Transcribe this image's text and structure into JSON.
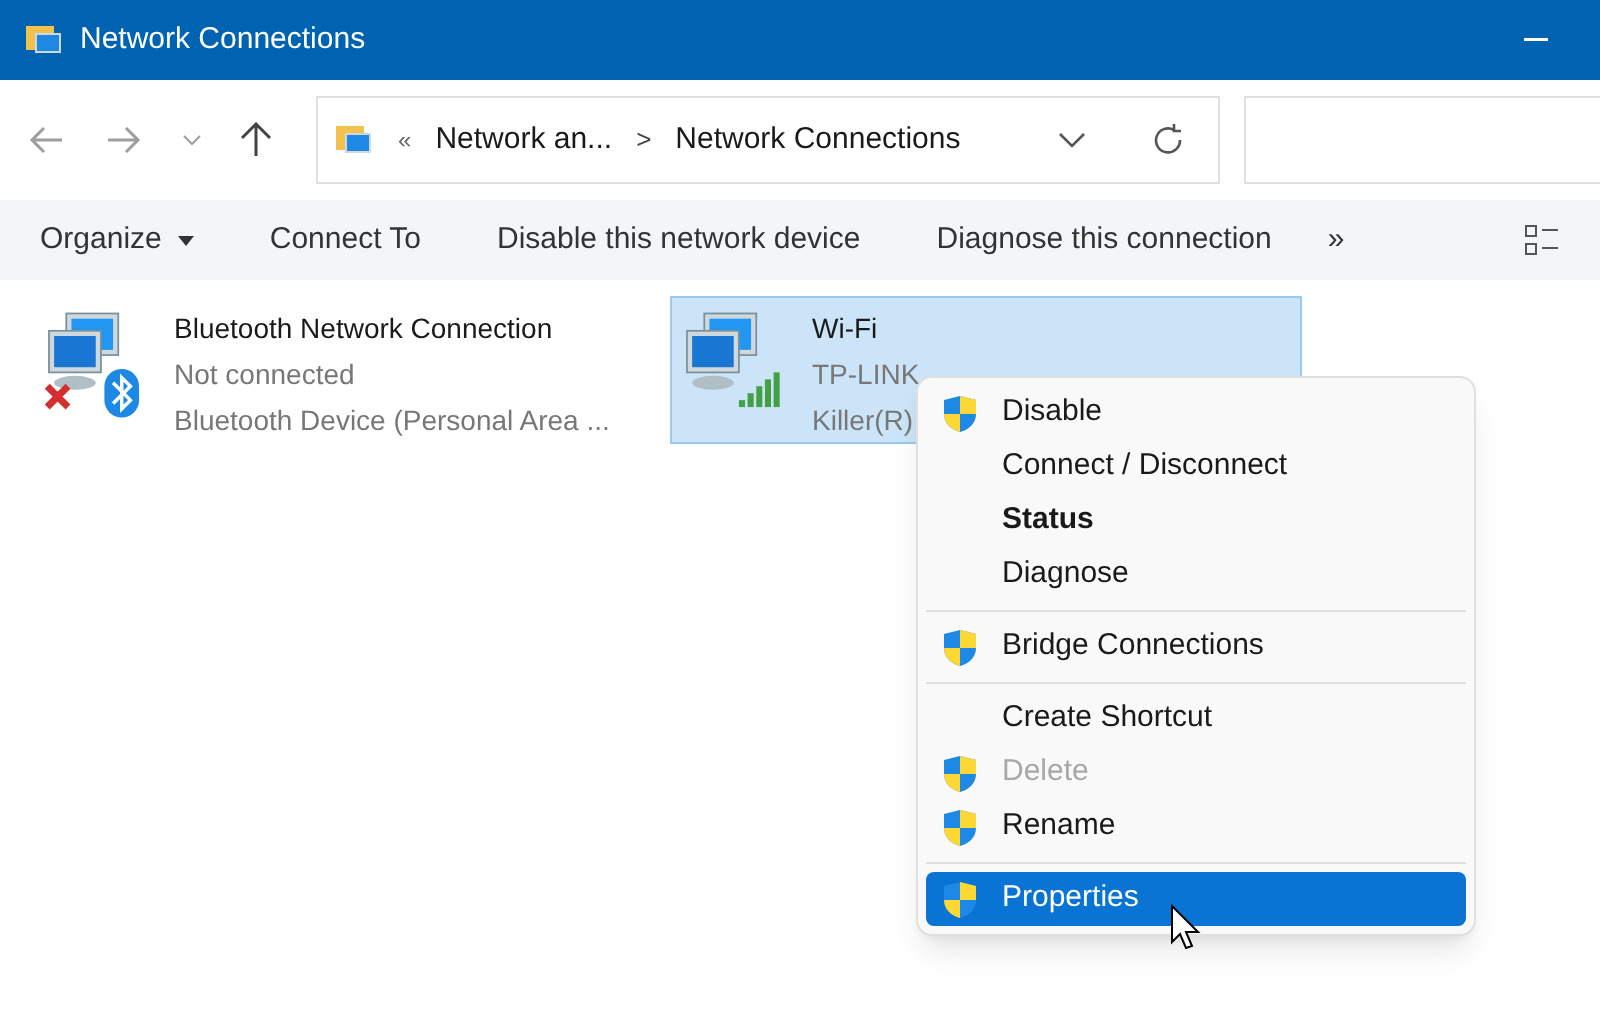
{
  "window": {
    "title": "Network Connections"
  },
  "address": {
    "overflow": "«",
    "crumbs": [
      "Network an...",
      "Network Connections"
    ],
    "separator": ">"
  },
  "commands": [
    {
      "label": "Organize",
      "dropdown": true
    },
    {
      "label": "Connect To",
      "dropdown": false
    },
    {
      "label": "Disable this network device",
      "dropdown": false
    },
    {
      "label": "Diagnose this connection",
      "dropdown": false
    }
  ],
  "more": "»",
  "connections": [
    {
      "name": "Bluetooth Network Connection",
      "status": "Not connected",
      "device": "Bluetooth Device (Personal Area ...",
      "kind": "bluetooth",
      "selected": false
    },
    {
      "name": "Wi-Fi",
      "status": "TP-LINK",
      "device": "Killer(R)",
      "kind": "wifi",
      "selected": true
    }
  ],
  "context_menu": {
    "groups": [
      [
        {
          "label": "Disable",
          "shield": true,
          "default": false,
          "disabled": false,
          "selected": false
        },
        {
          "label": "Connect / Disconnect",
          "shield": false,
          "default": false,
          "disabled": false,
          "selected": false
        },
        {
          "label": "Status",
          "shield": false,
          "default": true,
          "disabled": false,
          "selected": false
        },
        {
          "label": "Diagnose",
          "shield": false,
          "default": false,
          "disabled": false,
          "selected": false
        }
      ],
      [
        {
          "label": "Bridge Connections",
          "shield": true,
          "default": false,
          "disabled": false,
          "selected": false
        }
      ],
      [
        {
          "label": "Create Shortcut",
          "shield": false,
          "default": false,
          "disabled": false,
          "selected": false
        },
        {
          "label": "Delete",
          "shield": true,
          "default": false,
          "disabled": true,
          "selected": false
        },
        {
          "label": "Rename",
          "shield": true,
          "default": false,
          "disabled": false,
          "selected": false
        }
      ],
      [
        {
          "label": "Properties",
          "shield": true,
          "default": false,
          "disabled": false,
          "selected": true
        }
      ]
    ]
  }
}
